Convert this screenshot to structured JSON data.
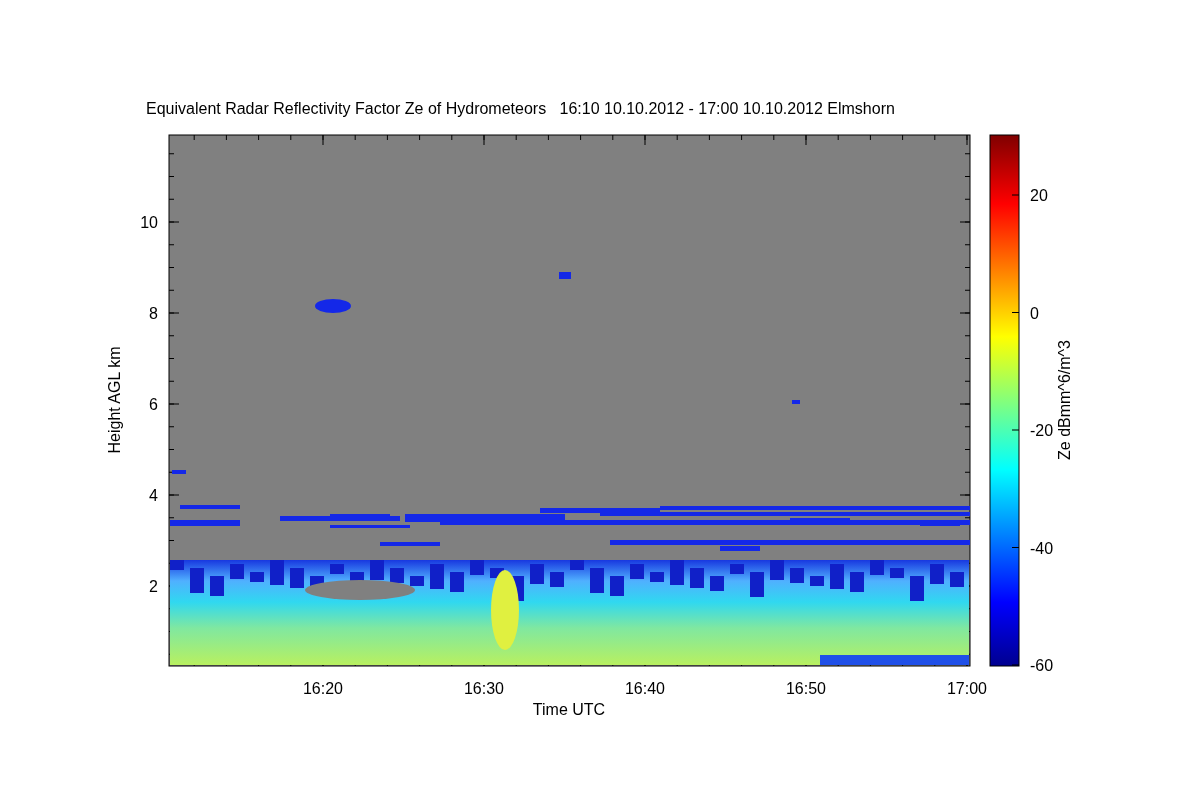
{
  "figure": {
    "title": "Equivalent Radar Reflectivity Factor Ze of Hydrometeors   16:10 10.10.2012 - 17:00 10.10.2012 Elmshorn",
    "x_axis": {
      "label": "Time UTC",
      "ticks": [
        "16:20",
        "16:30",
        "16:40",
        "16:50",
        "17:00"
      ]
    },
    "y_axis": {
      "label": "Height AGL km",
      "ticks": [
        "10",
        "8",
        "6",
        "4",
        "2"
      ]
    },
    "colorbar": {
      "label": "Ze dBmm^6/m^3",
      "ticks": [
        "20",
        "0",
        "-20",
        "-40",
        "-60"
      ]
    }
  }
}
